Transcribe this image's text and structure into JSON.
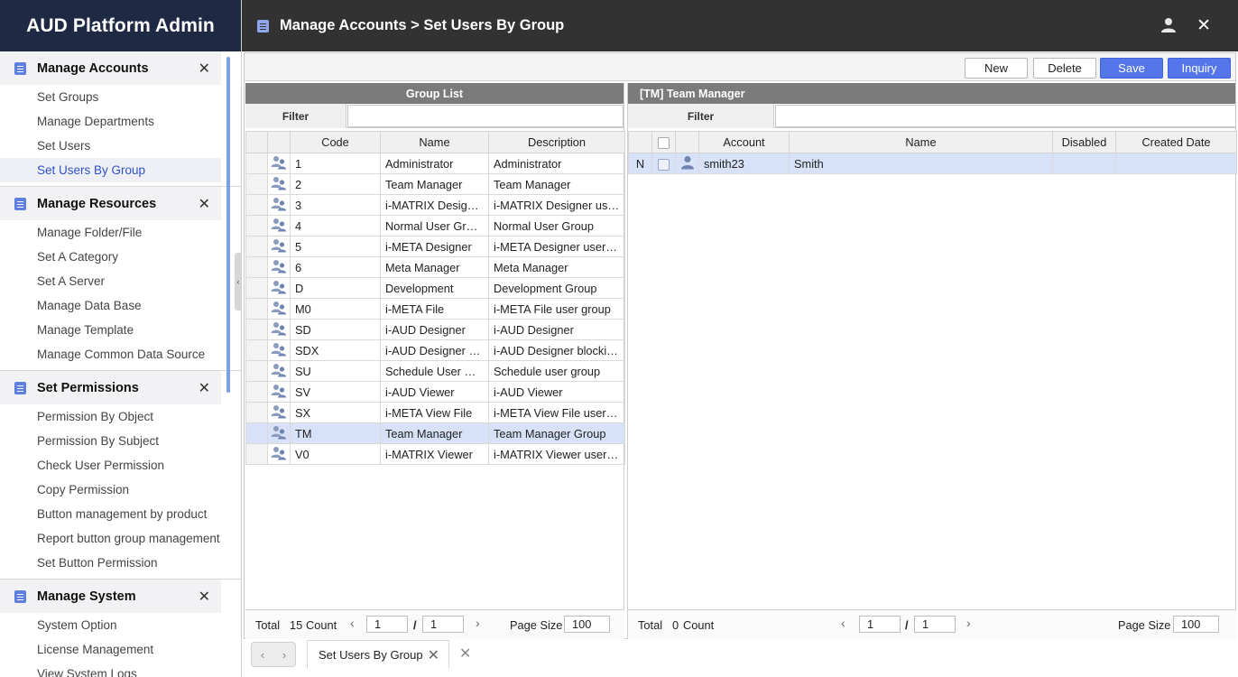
{
  "app": {
    "title": "AUD Platform Admin"
  },
  "header": {
    "breadcrumb": "Manage Accounts > Set Users By Group",
    "user_icon": "user-icon",
    "close": "✕"
  },
  "sidebar": {
    "sections": [
      {
        "title": "Manage Accounts",
        "items": [
          "Set Groups",
          "Manage Departments",
          "Set Users",
          "Set Users By Group"
        ]
      },
      {
        "title": "Manage Resources",
        "items": [
          "Manage Folder/File",
          "Set A Category",
          "Set A Server",
          "Manage Data Base",
          "Manage Template",
          "Manage Common Data Source"
        ]
      },
      {
        "title": "Set Permissions",
        "items": [
          "Permission By Object",
          "Permission By Subject",
          "Check User Permission",
          "Copy Permission",
          "Button management by product",
          "Report button group management",
          "Set Button Permission"
        ]
      },
      {
        "title": "Manage System",
        "items": [
          "System Option",
          "License Management",
          "View System Logs"
        ]
      }
    ],
    "active_item": "Set Users By Group"
  },
  "toolbar": {
    "new_label": "New",
    "delete_label": "Delete",
    "save_label": "Save",
    "inquiry_label": "Inquiry"
  },
  "group_panel": {
    "title": "Group List",
    "filter_label": "Filter",
    "filter_value": "",
    "columns": [
      "Code",
      "Name",
      "Description"
    ],
    "rows": [
      {
        "code": "1",
        "name": "Administrator",
        "description": "Administrator"
      },
      {
        "code": "2",
        "name": "Team Manager",
        "description": "Team Manager"
      },
      {
        "code": "3",
        "name": "i-MATRIX Designer",
        "description": "i-MATRIX Designer user …"
      },
      {
        "code": "4",
        "name": "Normal User Group",
        "description": "Normal User Group"
      },
      {
        "code": "5",
        "name": "i-META Designer",
        "description": "i-META Designer user gr…"
      },
      {
        "code": "6",
        "name": "Meta Manager",
        "description": "Meta Manager"
      },
      {
        "code": "D",
        "name": "Development",
        "description": "Development Group"
      },
      {
        "code": "M0",
        "name": "i-META File",
        "description": "i-META File user group"
      },
      {
        "code": "SD",
        "name": "i-AUD Designer",
        "description": "i-AUD Designer"
      },
      {
        "code": "SDX",
        "name": "i-AUD Designer blo…",
        "description": "i-AUD Designer blocking…"
      },
      {
        "code": "SU",
        "name": "Schedule User Gro…",
        "description": "Schedule user group"
      },
      {
        "code": "SV",
        "name": "i-AUD Viewer",
        "description": "i-AUD Viewer"
      },
      {
        "code": "SX",
        "name": "i-META View File",
        "description": "i-META View File user gr…"
      },
      {
        "code": "TM",
        "name": "Team Manager",
        "description": "Team Manager Group"
      },
      {
        "code": "V0",
        "name": "i-MATRIX Viewer",
        "description": "i-MATRIX Viewer user gr…"
      }
    ],
    "selected_code": "TM",
    "footer": {
      "total_label": "Total",
      "count": "15",
      "count_label": "Count",
      "page": "1",
      "sep": "/",
      "pages": "1",
      "page_size_label": "Page Size",
      "page_size": "100"
    }
  },
  "user_panel": {
    "title": "[TM] Team Manager",
    "filter_label": "Filter",
    "filter_value": "",
    "columns": [
      "Account",
      "Name",
      "Disabled",
      "Created Date"
    ],
    "rows": [
      {
        "status": "N",
        "checked": false,
        "account": "smith23",
        "name": "Smith",
        "disabled": "",
        "created": ""
      }
    ],
    "footer": {
      "total_label": "Total",
      "count": "0",
      "count_label": "Count",
      "page": "1",
      "sep": "/",
      "pages": "1",
      "page_size_label": "Page Size",
      "page_size": "100"
    }
  },
  "tabs": [
    {
      "label": "Set Users By Group"
    }
  ],
  "colors": {
    "brand_bg": "#1e2a44",
    "header_bg": "#323232",
    "accent": "#5576ea",
    "selected_row": "#d7e1f7",
    "panel_head": "#7b7b7b"
  }
}
